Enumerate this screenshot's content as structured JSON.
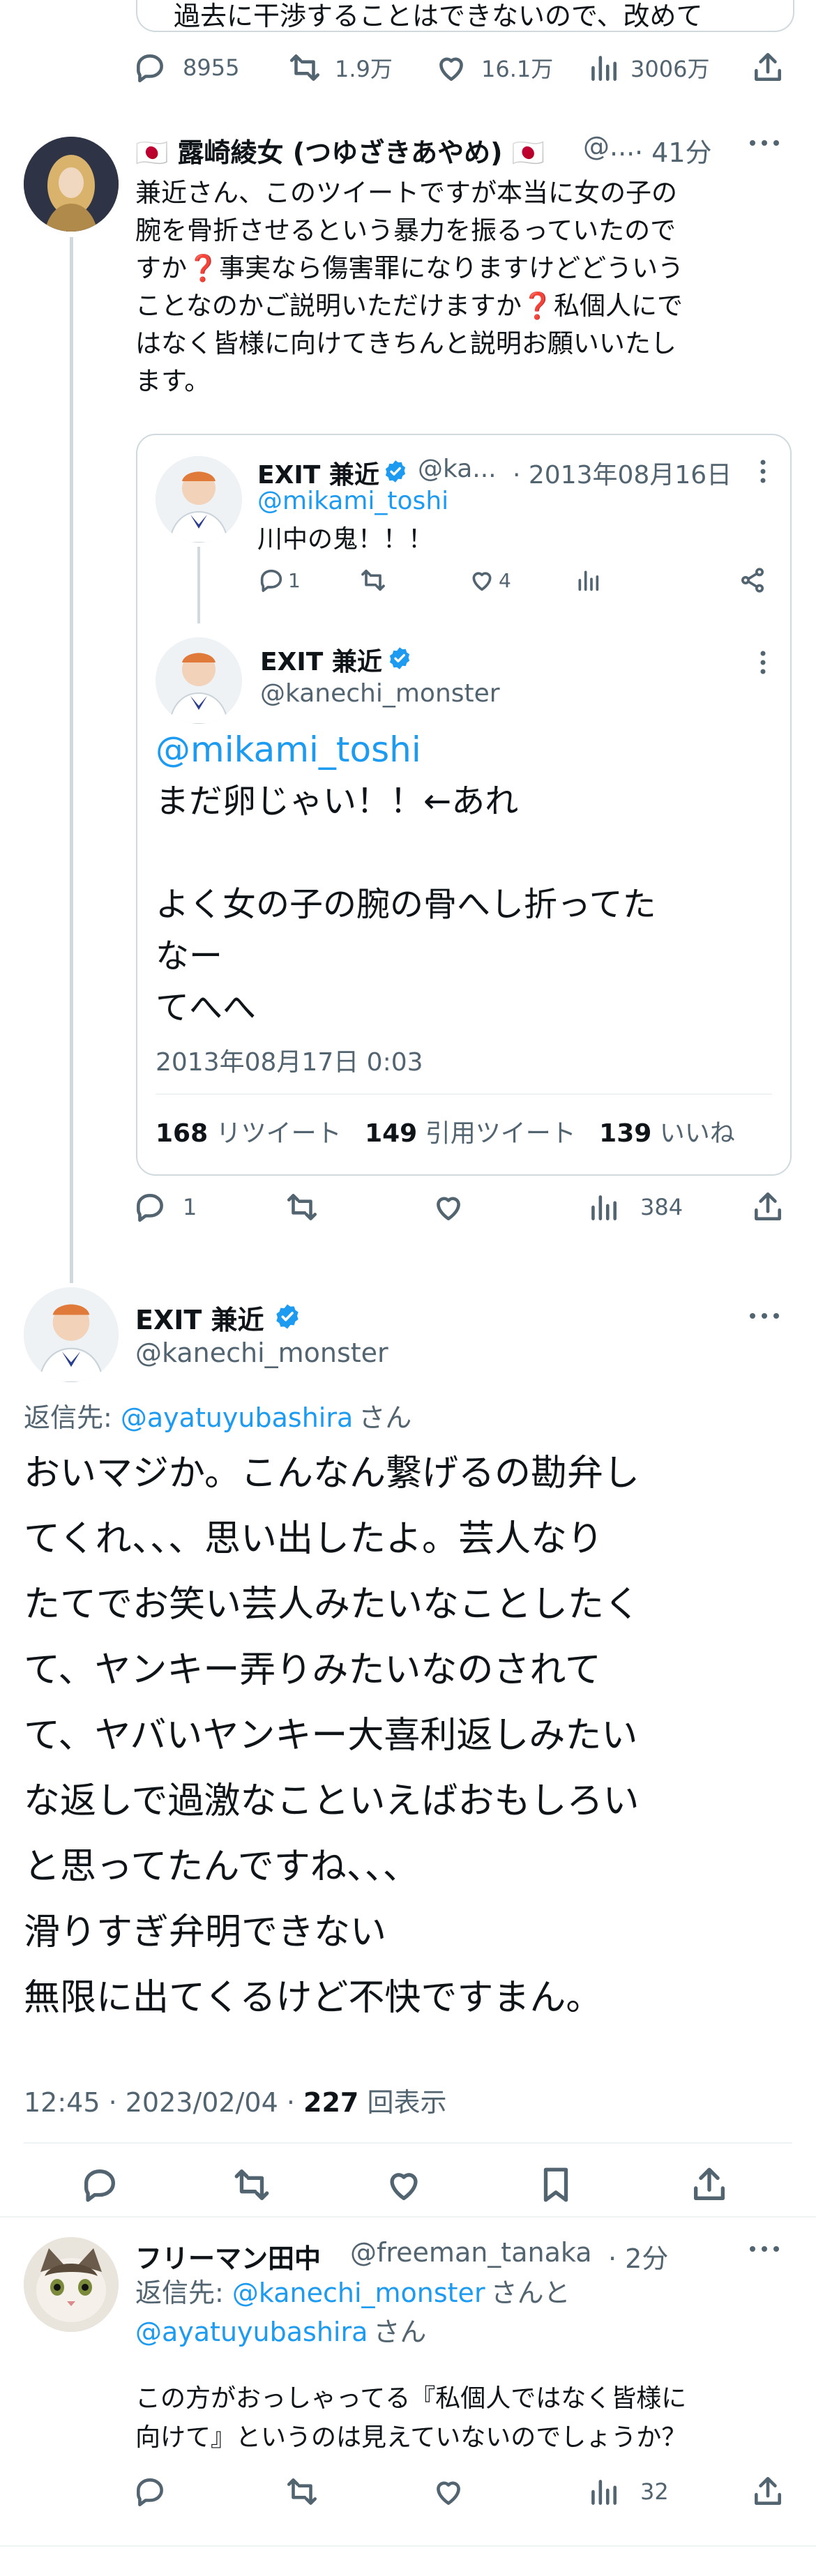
{
  "top_tweet": {
    "clipped_text": "過去に干渉することはできないので、改めて",
    "replies": "8955",
    "retweets": "1.9万",
    "likes": "16.1万",
    "views": "3006万"
  },
  "reply1": {
    "name": "🇯🇵 露崎綾女 (つゆざきあやめ) 🇯🇵",
    "handle": "@...",
    "time": "· 41分",
    "text": "兼近さん、このツイートですが本当に女の子の\n腕を骨折させるという暴力を振るっていたので\nすか❓事実なら傷害罪になりますけどどういう\nことなのかご説明いただけますか❓私個人にで\nはなく皆様に向けてきちんと説明お願いいたし\nます。",
    "replies": "1",
    "views": "384",
    "quote": {
      "parent": {
        "name": "EXIT 兼近",
        "handle": "@ka...",
        "date": "· 2013年08月16日",
        "mention": "@mikami_toshi",
        "text": "川中の鬼！！！",
        "replies": "1",
        "likes": "4"
      },
      "main": {
        "name": "EXIT 兼近",
        "handle": "@kanechi_monster",
        "mention": "@mikami_toshi",
        "text": "まだ卵じゃい！！←あれ\n\nよく女の子の腕の骨へし折ってた\nなー\nてへへ",
        "datetime": "2013年08月17日 0:03",
        "rt_count": "168",
        "rt_label": "リツイート",
        "qt_count": "149",
        "qt_label": "引用ツイート",
        "like_count": "139",
        "like_label": "いいね"
      }
    }
  },
  "main_tweet": {
    "name": "EXIT 兼近",
    "handle": "@kanechi_monster",
    "reply_to_label": "返信先: ",
    "reply_to_user": "@ayatuyubashira",
    "reply_to_suffix": "さん",
    "text": "おいマジか。こんなん繋げるの勘弁し\nてくれ、、、思い出したよ。芸人なり\nたてでお笑い芸人みたいなことしたく\nて、ヤンキー弄りみたいなのされて\nて、ヤバいヤンキー大喜利返しみたい\nな返しで過激なこといえばおもしろい\nと思ってたんですね、、、\n滑りすぎ弁明できない\n無限に出てくるけど不快ですまん。",
    "timestamp": "12:45 · 2023/02/04 · ",
    "view_count": "227",
    "view_label": "回表示"
  },
  "reply2": {
    "name": "フリーマン田中",
    "handle": "@freeman_tanaka",
    "time": "· 2分",
    "reply_to_label": "返信先: ",
    "reply_to_user1": "@kanechi_monster",
    "reply_to_mid": "さんと",
    "reply_to_user2": "@ayatuyubashira",
    "reply_to_suffix": "さん",
    "text": "この方がおっしゃってる『私個人ではなく皆様に\n向けて』というのは見えていないのでしょうか？",
    "views": "32"
  },
  "colors": {
    "accent": "#1d9bf0",
    "secondary_text": "#536471",
    "divider": "#eff3f4",
    "verified": "#1d9bf0"
  }
}
